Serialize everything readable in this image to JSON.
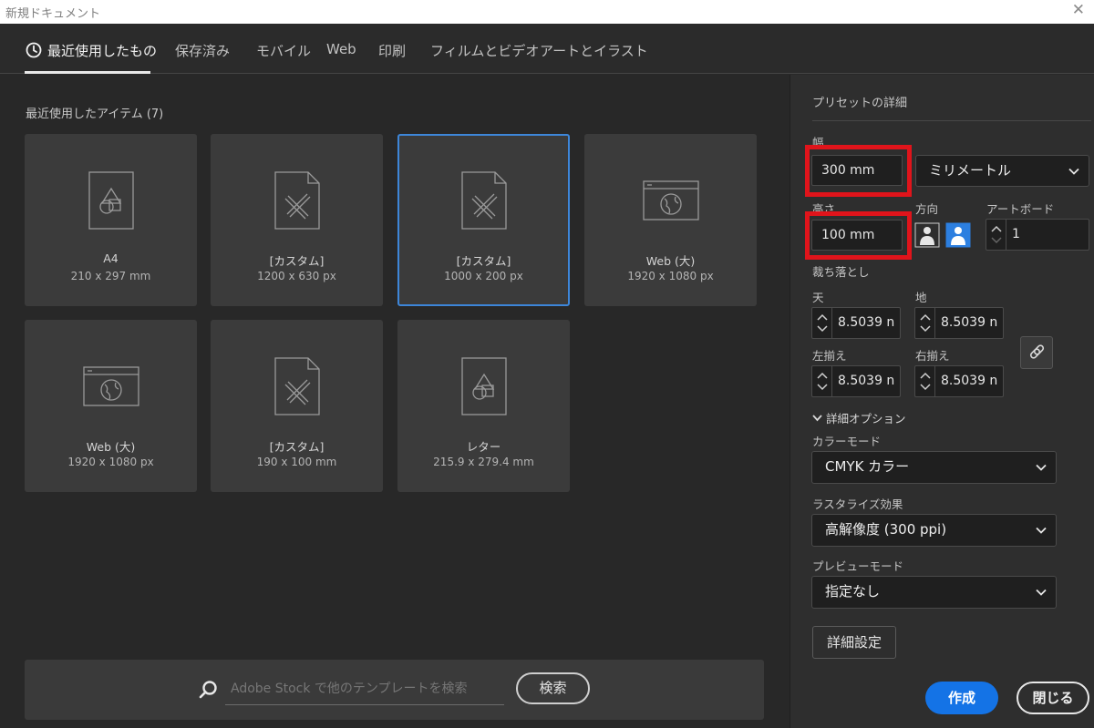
{
  "window": {
    "title": "新規ドキュメント",
    "close": "✕"
  },
  "tabs": [
    "最近使用したもの",
    "保存済み",
    "モバイル",
    "Web",
    "印刷",
    "フィルムとビデオ",
    "アートとイラスト"
  ],
  "recent": {
    "title": "最近使用したアイテム",
    "count": "(7)",
    "items": [
      {
        "name": "A4",
        "size": "210 x 297 mm",
        "icon": "document-shapes-icon"
      },
      {
        "name": "[カスタム]",
        "size": "1200 x 630 px",
        "icon": "document-pencil-ruler-icon"
      },
      {
        "name": "[カスタム]",
        "size": "1000 x 200 px",
        "icon": "document-pencil-ruler-icon",
        "selected": true
      },
      {
        "name": "Web (大)",
        "size": "1920 x 1080 px",
        "icon": "web-globe-icon"
      },
      {
        "name": "Web (大)",
        "size": "1920 x 1080 px",
        "icon": "web-globe-icon"
      },
      {
        "name": "[カスタム]",
        "size": "190 x 100 mm",
        "icon": "document-pencil-ruler-icon"
      },
      {
        "name": "レター",
        "size": "215.9 x 279.4 mm",
        "icon": "document-shapes-icon"
      }
    ]
  },
  "search": {
    "placeholder": "Adobe Stock で他のテンプレートを検索",
    "button": "検索"
  },
  "preset": {
    "heading": "プリセットの詳細",
    "width_label": "幅",
    "width_value": "300 mm",
    "unit": "ミリメートル",
    "height_label": "高さ",
    "height_value": "100 mm",
    "orientation_label": "方向",
    "artboard_label": "アートボード",
    "artboard_value": "1",
    "bleed_label": "裁ち落とし",
    "bleed_top_label": "天",
    "bleed_bottom_label": "地",
    "bleed_left_label": "左揃え",
    "bleed_right_label": "右揃え",
    "bleed_top": "8.5039 n",
    "bleed_bottom": "8.5039 n",
    "bleed_left": "8.5039 n",
    "bleed_right": "8.5039 n",
    "advanced_toggle": "詳細オプション",
    "color_mode_label": "カラーモード",
    "color_mode": "CMYK カラー",
    "raster_label": "ラスタライズ効果",
    "raster": "高解像度 (300 ppi)",
    "preview_label": "プレビューモード",
    "preview": "指定なし",
    "more_settings": "詳細設定",
    "create": "作成",
    "close": "閉じる"
  },
  "colors": {
    "accent": "#1473e6",
    "selected_border": "#3d86d9",
    "highlight": "#e0141b"
  }
}
